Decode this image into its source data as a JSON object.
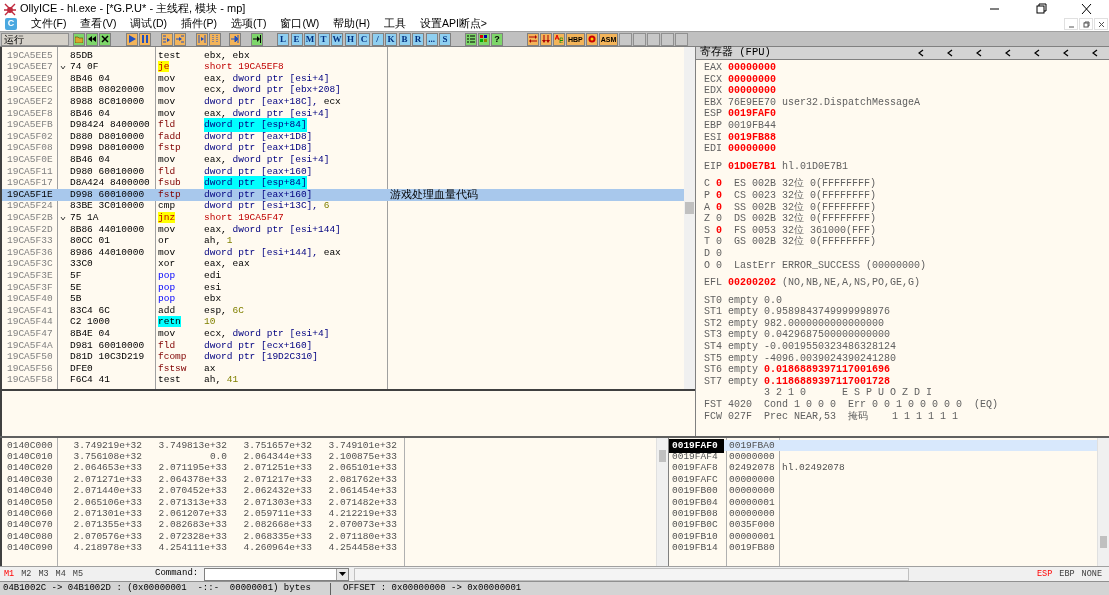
{
  "window": {
    "title": "OllyICE - hl.exe - [*G.P.U* -  主线程, 模块 - mp]"
  },
  "menu": {
    "icon_letter": "C",
    "items": [
      "文件(F)",
      "查看(V)",
      "调试(D)",
      "插件(P)",
      "选项(T)",
      "窗口(W)",
      "帮助(H)",
      "工具",
      "设置API断点>"
    ]
  },
  "toolbar": {
    "status": "运行",
    "letter_buttons": [
      "L",
      "E",
      "M",
      "T",
      "W",
      "H",
      "C",
      "/",
      "K",
      "B",
      "R",
      "...",
      "S"
    ],
    "help_button": "?",
    "tool_buttons": [
      "HBP",
      "ASM"
    ]
  },
  "disassembly": {
    "rows": [
      {
        "address": "19CA5EE5",
        "hex": "85DB",
        "mnemonic": "test",
        "kind": "normal",
        "operands": [
          {
            "text": "ebx, ebx",
            "kind": "reg"
          }
        ],
        "selected": false
      },
      {
        "address": "19CA5EE7",
        "hex": "74 0F",
        "jump_mark": true,
        "mnemonic": "je",
        "kind": "jump",
        "operands": [
          {
            "text": "short 19CA5EF8",
            "kind": "target"
          }
        ],
        "selected": false
      },
      {
        "address": "19CA5EE9",
        "hex": "8B46 04",
        "mnemonic": "mov",
        "kind": "normal",
        "operands": [
          {
            "text": "eax,",
            "kind": "reg"
          },
          {
            "text": "dword ptr [esi+4]",
            "kind": "mem"
          }
        ],
        "selected": false
      },
      {
        "address": "19CA5EEC",
        "hex": "8B8B 08020000",
        "mnemonic": "mov",
        "kind": "normal",
        "operands": [
          {
            "text": "ecx,",
            "kind": "reg"
          },
          {
            "text": "dword ptr [ebx+208]",
            "kind": "mem"
          }
        ],
        "selected": false
      },
      {
        "address": "19CA5EF2",
        "hex": "8988 8C010000",
        "mnemonic": "mov",
        "kind": "normal",
        "operands": [
          {
            "text": "dword ptr [eax+18C],",
            "kind": "mem"
          },
          {
            "text": "ecx",
            "kind": "reg"
          }
        ],
        "selected": false
      },
      {
        "address": "19CA5EF8",
        "hex": "8B46 04",
        "mnemonic": "mov",
        "kind": "normal",
        "operands": [
          {
            "text": "eax,",
            "kind": "reg"
          },
          {
            "text": "dword ptr [esi+4]",
            "kind": "mem"
          }
        ],
        "selected": false
      },
      {
        "address": "19CA5EFB",
        "hex": "D98424 8400000",
        "mnemonic": "fld",
        "kind": "fpu",
        "operands": [
          {
            "text": "dword ptr [esp+84]",
            "kind": "highlight"
          }
        ],
        "selected": false
      },
      {
        "address": "19CA5F02",
        "hex": "D880 D8010000",
        "mnemonic": "fadd",
        "kind": "fpu",
        "operands": [
          {
            "text": "dword ptr [eax+1D8]",
            "kind": "mem"
          }
        ],
        "selected": false
      },
      {
        "address": "19CA5F08",
        "hex": "D998 D8010000",
        "mnemonic": "fstp",
        "kind": "fpu",
        "operands": [
          {
            "text": "dword ptr [eax+1D8]",
            "kind": "mem"
          }
        ],
        "selected": false
      },
      {
        "address": "19CA5F0E",
        "hex": "8B46 04",
        "mnemonic": "mov",
        "kind": "normal",
        "operands": [
          {
            "text": "eax,",
            "kind": "reg"
          },
          {
            "text": "dword ptr [esi+4]",
            "kind": "mem"
          }
        ],
        "selected": false
      },
      {
        "address": "19CA5F11",
        "hex": "D980 60010000",
        "mnemonic": "fld",
        "kind": "fpu",
        "operands": [
          {
            "text": "dword ptr [eax+160]",
            "kind": "mem"
          }
        ],
        "selected": false
      },
      {
        "address": "19CA5F17",
        "hex": "D8A424 8400000",
        "mnemonic": "fsub",
        "kind": "fpu",
        "operands": [
          {
            "text": "dword ptr [esp+84]",
            "kind": "highlight"
          }
        ],
        "selected": false
      },
      {
        "address": "19CA5F1E",
        "hex": "D998 60010000",
        "mnemonic": "fstp",
        "kind": "fpu",
        "operands": [
          {
            "text": "dword ptr [eax+160]",
            "kind": "mem"
          }
        ],
        "comment": "游戏处理血量代码",
        "selected": true
      },
      {
        "address": "19CA5F24",
        "hex": "83BE 3C010000",
        "mnemonic": "cmp",
        "kind": "normal",
        "operands": [
          {
            "text": "dword ptr [esi+13C],",
            "kind": "mem"
          },
          {
            "text": "6",
            "kind": "imm"
          }
        ],
        "selected": false
      },
      {
        "address": "19CA5F2B",
        "hex": "75 1A",
        "jump_mark": true,
        "mnemonic": "jnz",
        "kind": "jump",
        "operands": [
          {
            "text": "short 19CA5F47",
            "kind": "target"
          }
        ],
        "selected": false
      },
      {
        "address": "19CA5F2D",
        "hex": "8B86 44010000",
        "mnemonic": "mov",
        "kind": "normal",
        "operands": [
          {
            "text": "eax,",
            "kind": "reg"
          },
          {
            "text": "dword ptr [esi+144]",
            "kind": "mem"
          }
        ],
        "selected": false
      },
      {
        "address": "19CA5F33",
        "hex": "80CC 01",
        "mnemonic": "or",
        "kind": "normal",
        "operands": [
          {
            "text": "ah,",
            "kind": "reg"
          },
          {
            "text": "1",
            "kind": "imm"
          }
        ],
        "selected": false
      },
      {
        "address": "19CA5F36",
        "hex": "8986 44010000",
        "mnemonic": "mov",
        "kind": "normal",
        "operands": [
          {
            "text": "dword ptr [esi+144],",
            "kind": "mem"
          },
          {
            "text": "eax",
            "kind": "reg"
          }
        ],
        "selected": false
      },
      {
        "address": "19CA5F3C",
        "hex": "33C0",
        "mnemonic": "xor",
        "kind": "normal",
        "operands": [
          {
            "text": "eax, eax",
            "kind": "reg"
          }
        ],
        "selected": false
      },
      {
        "address": "19CA5F3E",
        "hex": "5F",
        "mnemonic": "pop",
        "kind": "stack",
        "operands": [
          {
            "text": "edi",
            "kind": "reg"
          }
        ],
        "selected": false
      },
      {
        "address": "19CA5F3F",
        "hex": "5E",
        "mnemonic": "pop",
        "kind": "stack",
        "operands": [
          {
            "text": "esi",
            "kind": "reg"
          }
        ],
        "selected": false
      },
      {
        "address": "19CA5F40",
        "hex": "5B",
        "mnemonic": "pop",
        "kind": "stack",
        "operands": [
          {
            "text": "ebx",
            "kind": "reg"
          }
        ],
        "selected": false
      },
      {
        "address": "19CA5F41",
        "hex": "83C4 6C",
        "mnemonic": "add",
        "kind": "normal",
        "operands": [
          {
            "text": "esp,",
            "kind": "reg"
          },
          {
            "text": "6C",
            "kind": "imm"
          }
        ],
        "selected": false
      },
      {
        "address": "19CA5F44",
        "hex": "C2 1000",
        "mnemonic": "retn",
        "kind": "ret",
        "operands": [
          {
            "text": "10",
            "kind": "imm"
          }
        ],
        "selected": false
      },
      {
        "address": "19CA5F47",
        "hex": "8B4E 04",
        "mnemonic": "mov",
        "kind": "normal",
        "operands": [
          {
            "text": "ecx,",
            "kind": "reg"
          },
          {
            "text": "dword ptr [esi+4]",
            "kind": "mem"
          }
        ],
        "selected": false
      },
      {
        "address": "19CA5F4A",
        "hex": "D981 60010000",
        "mnemonic": "fld",
        "kind": "fpu",
        "operands": [
          {
            "text": "dword ptr [ecx+160]",
            "kind": "mem"
          }
        ],
        "selected": false
      },
      {
        "address": "19CA5F50",
        "hex": "D81D 10C3D219",
        "mnemonic": "fcomp",
        "kind": "fpu",
        "operands": [
          {
            "text": "dword ptr [19D2C310]",
            "kind": "mem"
          }
        ],
        "selected": false
      },
      {
        "address": "19CA5F56",
        "hex": "DFE0",
        "mnemonic": "fstsw",
        "kind": "fpu",
        "operands": [
          {
            "text": "ax",
            "kind": "reg"
          }
        ],
        "selected": false
      },
      {
        "address": "19CA5F58",
        "hex": "F6C4 41",
        "mnemonic": "test",
        "kind": "normal",
        "operands": [
          {
            "text": "ah,",
            "kind": "reg"
          },
          {
            "text": "41",
            "kind": "imm"
          }
        ],
        "selected": false
      }
    ]
  },
  "registers": {
    "title": "寄存器 (FPU)",
    "general": [
      {
        "name": "EAX",
        "value": "00000000",
        "changed": true
      },
      {
        "name": "ECX",
        "value": "00000000",
        "changed": true
      },
      {
        "name": "EDX",
        "value": "00000000",
        "changed": true
      },
      {
        "name": "EBX",
        "value": "76E9EE70",
        "changed": false,
        "comment": "user32.DispatchMessageA"
      },
      {
        "name": "ESP",
        "value": "0019FAF0",
        "changed": true
      },
      {
        "name": "EBP",
        "value": "0019FB44",
        "changed": false
      },
      {
        "name": "ESI",
        "value": "0019FB88",
        "changed": true
      },
      {
        "name": "EDI",
        "value": "00000000",
        "changed": true
      }
    ],
    "eip": {
      "name": "EIP",
      "value": "01D0E7B1",
      "changed": true,
      "comment": "hl.01D0E7B1"
    },
    "flags": [
      {
        "flag": "C",
        "value": "0",
        "changed": true,
        "segment": "ES 002B 32位 0(FFFFFFFF)"
      },
      {
        "flag": "P",
        "value": "0",
        "changed": true,
        "segment": "CS 0023 32位 0(FFFFFFFF)"
      },
      {
        "flag": "A",
        "value": "0",
        "changed": true,
        "segment": "SS 002B 32位 0(FFFFFFFF)"
      },
      {
        "flag": "Z",
        "value": "0",
        "changed": false,
        "segment": "DS 002B 32位 0(FFFFFFFF)"
      },
      {
        "flag": "S",
        "value": "0",
        "changed": true,
        "segment": "FS 0053 32位 361000(FFF)"
      },
      {
        "flag": "T",
        "value": "0",
        "changed": false,
        "segment": "GS 002B 32位 0(FFFFFFFF)"
      },
      {
        "flag": "D",
        "value": "0",
        "changed": false
      },
      {
        "flag": "O",
        "value": "0",
        "changed": false,
        "segment": "LastErr ERROR_SUCCESS (00000000)"
      }
    ],
    "efl": {
      "name": "EFL",
      "value": "00200202",
      "changed": true,
      "comment": "(NO,NB,NE,A,NS,PO,GE,G)"
    },
    "fpu": [
      {
        "name": "ST0",
        "tag": "empty",
        "value": "0.0",
        "changed": false
      },
      {
        "name": "ST1",
        "tag": "empty",
        "value": "0.9589843749999998976",
        "changed": false
      },
      {
        "name": "ST2",
        "tag": "empty",
        "value": "982.0000000000000000",
        "changed": false
      },
      {
        "name": "ST3",
        "tag": "empty",
        "value": "0.0429687500000000000",
        "changed": false
      },
      {
        "name": "ST4",
        "tag": "empty",
        "value": "-0.0019550323486328124",
        "changed": false
      },
      {
        "name": "ST5",
        "tag": "empty",
        "value": "-4096.0039024390241280",
        "changed": false
      },
      {
        "name": "ST6",
        "tag": "empty",
        "value": "0.0186889397117001696",
        "changed": true
      },
      {
        "name": "ST7",
        "tag": "empty",
        "value": "0.1186889397117001728",
        "changed": true
      }
    ],
    "status_lines": [
      "          3 2 1 0      E S P U O Z D I",
      "FST 4020  Cond 1 0 0 0  Err 0 0 1 0 0 0 0 0  (EQ)",
      "FCW 027F  Prec NEAR,53  掩码    1 1 1 1 1 1"
    ]
  },
  "dump": {
    "rows": [
      {
        "address": "0140C000",
        "values": [
          "3.749219e+32",
          "3.749813e+32",
          "3.751657e+32",
          "3.749101e+32"
        ]
      },
      {
        "address": "0140C010",
        "values": [
          "3.756108e+32",
          "0.0",
          "2.064344e+33",
          "2.100875e+33"
        ]
      },
      {
        "address": "0140C020",
        "values": [
          "2.064653e+33",
          "2.071195e+33",
          "2.071251e+33",
          "2.065101e+33"
        ]
      },
      {
        "address": "0140C030",
        "values": [
          "2.071271e+33",
          "2.064378e+33",
          "2.071217e+33",
          "2.081762e+33"
        ]
      },
      {
        "address": "0140C040",
        "values": [
          "2.071440e+33",
          "2.070452e+33",
          "2.062432e+33",
          "2.061454e+33"
        ]
      },
      {
        "address": "0140C050",
        "values": [
          "2.065106e+33",
          "2.071313e+33",
          "2.071303e+33",
          "2.071482e+33"
        ]
      },
      {
        "address": "0140C060",
        "values": [
          "2.071301e+33",
          "2.061207e+33",
          "2.059711e+33",
          "4.212219e+33"
        ]
      },
      {
        "address": "0140C070",
        "values": [
          "2.071355e+33",
          "2.082683e+33",
          "2.082668e+33",
          "2.070073e+33"
        ]
      },
      {
        "address": "0140C080",
        "values": [
          "2.070576e+33",
          "2.072328e+33",
          "2.068335e+33",
          "2.071180e+33"
        ]
      },
      {
        "address": "0140C090",
        "values": [
          "4.218978e+33",
          "4.254111e+33",
          "4.260964e+33",
          "4.254458e+33"
        ]
      }
    ]
  },
  "stack": {
    "rows": [
      {
        "address": "0019FAF0",
        "value": "0019FBA0",
        "selected": true
      },
      {
        "address": "0019FAF4",
        "value": "00000000",
        "selected": false
      },
      {
        "address": "0019FAF8",
        "value": "02492078",
        "comment": "hl.02492078",
        "selected": false
      },
      {
        "address": "0019FAFC",
        "value": "00000000",
        "selected": false
      },
      {
        "address": "0019FB00",
        "value": "00000000",
        "selected": false
      },
      {
        "address": "0019FB04",
        "value": "00000001",
        "selected": false
      },
      {
        "address": "0019FB08",
        "value": "00000000",
        "selected": false
      },
      {
        "address": "0019FB0C",
        "value": "0035F000",
        "selected": false
      },
      {
        "address": "0019FB10",
        "value": "00000001",
        "selected": false
      },
      {
        "address": "0019FB14",
        "value": "0019FB80",
        "selected": false
      }
    ]
  },
  "memory_tabs": [
    {
      "label": "M1",
      "selected": true
    },
    {
      "label": "M2",
      "selected": false
    },
    {
      "label": "M3",
      "selected": false
    },
    {
      "label": "M4",
      "selected": false
    },
    {
      "label": "M5",
      "selected": false
    }
  ],
  "command": {
    "label": "Command:"
  },
  "stack_modes": [
    {
      "label": "ESP",
      "selected": true
    },
    {
      "label": "EBP",
      "selected": false
    },
    {
      "label": "NONE",
      "selected": false
    }
  ],
  "status_bar": {
    "selection": "04B1002C -> 04B1002D : (0x00000001  -::-  00000001) bytes",
    "offset": "OFFSET : 0x00000000 -> 0x00000001"
  }
}
